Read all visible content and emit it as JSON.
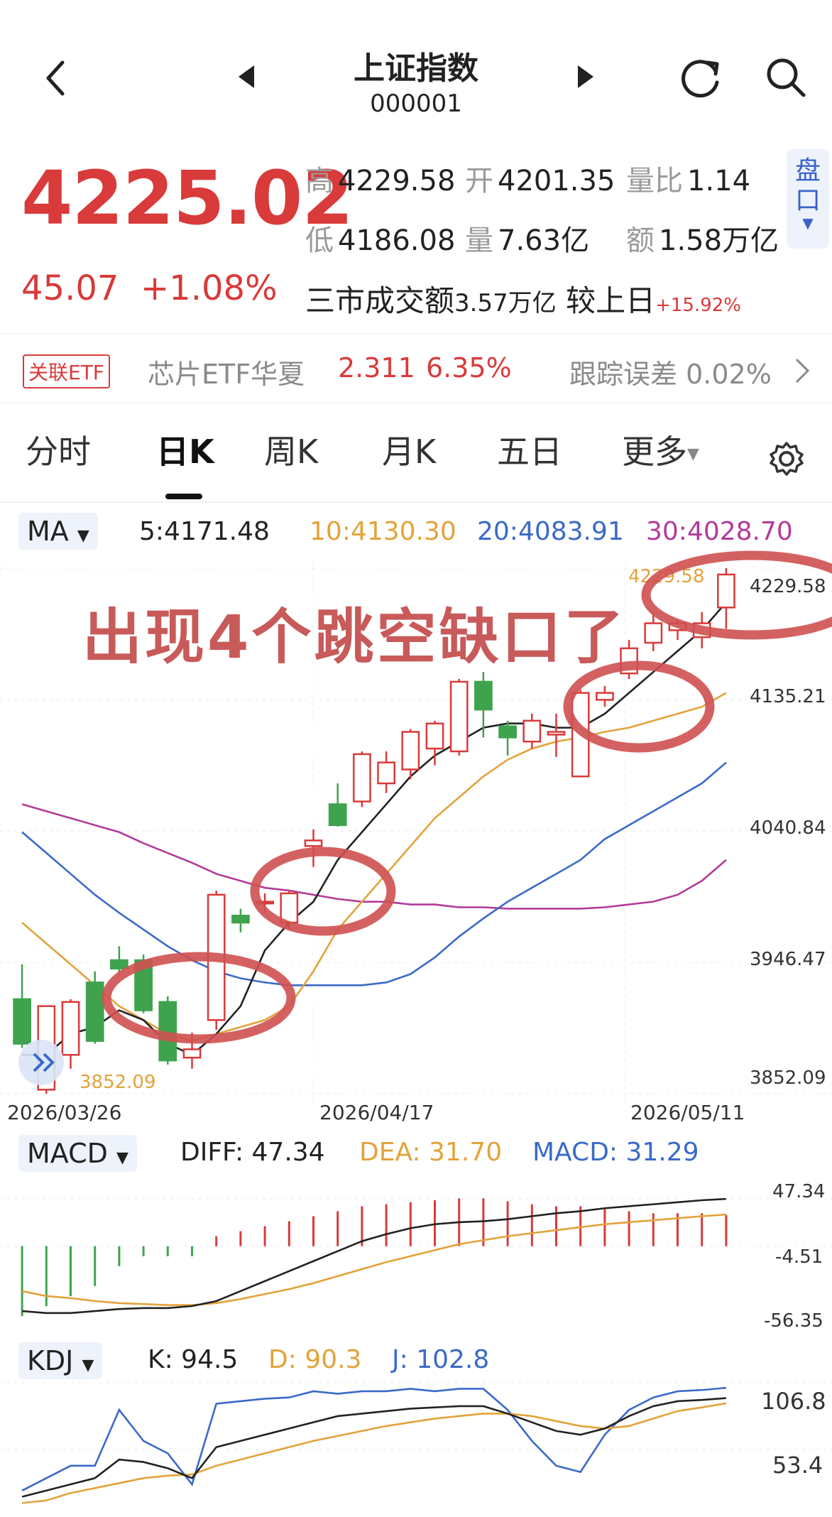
{
  "header": {
    "title": "上证指数",
    "code": "000001"
  },
  "quote": {
    "price": "4225.02",
    "change": "45.07",
    "change_pct": "+1.08%",
    "high_label": "高",
    "high": "4229.58",
    "open_label": "开",
    "open": "4201.35",
    "vol_ratio_label": "量比",
    "vol_ratio": "1.14",
    "low_label": "低",
    "low": "4186.08",
    "volume_label": "量",
    "volume": "7.63亿",
    "amount_label": "额",
    "amount": "1.58万亿",
    "market_label": "三市成交额",
    "market_amount": "3.57万亿",
    "vs_label": "较上日",
    "vs_value": "+15.92%",
    "pan_button": "盘口"
  },
  "etf": {
    "tag": "关联ETF",
    "name": "芯片ETF华夏",
    "price": "2.311",
    "pct": "6.35%",
    "track_label": "跟踪误差",
    "track_value": "0.02%"
  },
  "tabs": [
    {
      "label": "分时"
    },
    {
      "label": "日K"
    },
    {
      "label": "周K"
    },
    {
      "label": "月K"
    },
    {
      "label": "五日"
    },
    {
      "label": "更多"
    }
  ],
  "active_tab": "日K",
  "ma": {
    "select": "MA",
    "ma5": "5:4171.48",
    "ma10": "10:4130.30",
    "ma20": "20:4083.91",
    "ma30": "30:4028.70"
  },
  "annotation": "出现4个跳空缺口了",
  "macd_bar": {
    "select": "MACD",
    "diff": "DIFF: 47.34",
    "dea": "DEA: 31.70",
    "macd": "MACD: 31.29"
  },
  "kdj_bar": {
    "select": "KDJ",
    "k": "K: 94.5",
    "d": "D: 90.3",
    "j": "J: 102.8"
  },
  "colors": {
    "up": "#d93a3a",
    "down": "#3fa34d",
    "ma5": "#222222",
    "ma10": "#e3a23a",
    "ma20": "#3a6ac8",
    "ma30": "#b23a9a"
  },
  "chart_data": [
    {
      "type": "candlestick",
      "y_labels": [
        "4229.58",
        "4135.21",
        "4040.84",
        "3946.47",
        "3852.09"
      ],
      "y_range": [
        3852.09,
        4229.58
      ],
      "x_labels": [
        "2026/03/26",
        "2026/04/17",
        "2026/05/11"
      ],
      "max_marker": "4229.58",
      "min_marker": "3852.09",
      "candles": [
        {
          "o": 3920,
          "h": 3945,
          "l": 3885,
          "c": 3888
        },
        {
          "o": 3855,
          "h": 3915,
          "l": 3852,
          "c": 3915
        },
        {
          "o": 3880,
          "h": 3920,
          "l": 3870,
          "c": 3918
        },
        {
          "o": 3932,
          "h": 3940,
          "l": 3888,
          "c": 3890
        },
        {
          "o": 3948,
          "h": 3958,
          "l": 3938,
          "c": 3942
        },
        {
          "o": 3948,
          "h": 3952,
          "l": 3910,
          "c": 3912
        },
        {
          "o": 3918,
          "h": 3922,
          "l": 3873,
          "c": 3876
        },
        {
          "o": 3878,
          "h": 3896,
          "l": 3870,
          "c": 3884
        },
        {
          "o": 3905,
          "h": 3998,
          "l": 3898,
          "c": 3995
        },
        {
          "o": 3980,
          "h": 3985,
          "l": 3968,
          "c": 3975
        },
        {
          "o": 3990,
          "h": 3996,
          "l": 3982,
          "c": 3990
        },
        {
          "o": 3975,
          "h": 3998,
          "l": 3970,
          "c": 3996
        },
        {
          "o": 4030,
          "h": 4042,
          "l": 4015,
          "c": 4034
        },
        {
          "o": 4060,
          "h": 4075,
          "l": 4044,
          "c": 4045
        },
        {
          "o": 4062,
          "h": 4098,
          "l": 4058,
          "c": 4096
        },
        {
          "o": 4075,
          "h": 4098,
          "l": 4068,
          "c": 4090
        },
        {
          "o": 4085,
          "h": 4114,
          "l": 4078,
          "c": 4112
        },
        {
          "o": 4100,
          "h": 4120,
          "l": 4088,
          "c": 4118
        },
        {
          "o": 4098,
          "h": 4150,
          "l": 4095,
          "c": 4148
        },
        {
          "o": 4148,
          "h": 4155,
          "l": 4108,
          "c": 4128
        },
        {
          "o": 4116,
          "h": 4120,
          "l": 4095,
          "c": 4108
        },
        {
          "o": 4105,
          "h": 4125,
          "l": 4100,
          "c": 4120
        },
        {
          "o": 4110,
          "h": 4125,
          "l": 4094,
          "c": 4112
        },
        {
          "o": 4080,
          "h": 4142,
          "l": 4080,
          "c": 4140
        },
        {
          "o": 4135,
          "h": 4145,
          "l": 4130,
          "c": 4140
        },
        {
          "o": 4154,
          "h": 4178,
          "l": 4150,
          "c": 4172
        },
        {
          "o": 4176,
          "h": 4198,
          "l": 4170,
          "c": 4190
        },
        {
          "o": 4185,
          "h": 4193,
          "l": 4178,
          "c": 4190
        },
        {
          "o": 4180,
          "h": 4198,
          "l": 4172,
          "c": 4190
        },
        {
          "o": 4201.35,
          "h": 4229.58,
          "l": 4186.08,
          "c": 4225.02
        }
      ],
      "ma_lines": {
        "ma5": [
          3880,
          3880,
          3895,
          3900,
          3912,
          3905,
          3888,
          3880,
          3895,
          3915,
          3955,
          3975,
          3990,
          4020,
          4040,
          4060,
          4080,
          4095,
          4105,
          4115,
          4118,
          4118,
          4115,
          4115,
          4125,
          4140,
          4155,
          4170,
          4185,
          4205
        ],
        "ma10": [
          3975,
          3960,
          3945,
          3930,
          3915,
          3905,
          3895,
          3890,
          3895,
          3900,
          3905,
          3915,
          3940,
          3970,
          3990,
          4010,
          4030,
          4050,
          4065,
          4080,
          4092,
          4100,
          4105,
          4108,
          4112,
          4115,
          4120,
          4125,
          4130,
          4140
        ],
        "ma20": [
          4040,
          4025,
          4010,
          3995,
          3982,
          3970,
          3958,
          3948,
          3940,
          3935,
          3932,
          3930,
          3930,
          3930,
          3930,
          3932,
          3938,
          3950,
          3965,
          3978,
          3990,
          4000,
          4010,
          4020,
          4035,
          4045,
          4055,
          4065,
          4075,
          4090
        ],
        "ma30": [
          4060,
          4055,
          4050,
          4045,
          4040,
          4032,
          4025,
          4018,
          4010,
          4005,
          4000,
          3998,
          3995,
          3992,
          3990,
          3990,
          3988,
          3988,
          3986,
          3986,
          3985,
          3985,
          3985,
          3985,
          3986,
          3988,
          3990,
          3995,
          4005,
          4020
        ]
      }
    },
    {
      "type": "bar",
      "name": "MACD",
      "y_labels": [
        "47.34",
        "-4.51",
        "-56.35"
      ],
      "y_range": [
        -56.35,
        47.34
      ],
      "hist": [
        -70,
        -60,
        -50,
        -40,
        -20,
        -10,
        -10,
        -10,
        10,
        15,
        20,
        25,
        30,
        35,
        40,
        42,
        44,
        46,
        48,
        48,
        45,
        42,
        40,
        40,
        38,
        35,
        33,
        33,
        33,
        31.29
      ],
      "diff": [
        -65,
        -67,
        -67,
        -65,
        -63,
        -62,
        -62,
        -60,
        -55,
        -45,
        -35,
        -25,
        -15,
        -5,
        5,
        12,
        18,
        22,
        24,
        25,
        27,
        30,
        33,
        35,
        38,
        40,
        42,
        44,
        46,
        47.34
      ],
      "dea": [
        -45,
        -50,
        -52,
        -55,
        -57,
        -58,
        -59,
        -59,
        -57,
        -53,
        -48,
        -43,
        -37,
        -30,
        -23,
        -16,
        -10,
        -4,
        2,
        6,
        10,
        13,
        16,
        19,
        22,
        24,
        26,
        28,
        30,
        31.7
      ]
    },
    {
      "type": "line",
      "name": "KDJ",
      "y_labels": [
        "106.8",
        "53.4"
      ],
      "y_range": [
        0,
        106.8
      ],
      "k": [
        15,
        20,
        25,
        30,
        45,
        43,
        38,
        30,
        55,
        60,
        65,
        70,
        75,
        80,
        82,
        84,
        86,
        87,
        88,
        88,
        82,
        75,
        68,
        65,
        70,
        80,
        88,
        92,
        93,
        94.5
      ],
      "d": [
        10,
        12,
        18,
        22,
        26,
        30,
        32,
        33,
        40,
        45,
        50,
        55,
        60,
        64,
        68,
        72,
        75,
        78,
        80,
        82,
        82,
        80,
        76,
        72,
        70,
        72,
        78,
        84,
        87,
        90.3
      ],
      "j": [
        20,
        30,
        40,
        40,
        85,
        60,
        50,
        25,
        90,
        92,
        94,
        95,
        100,
        98,
        100,
        100,
        102,
        100,
        102,
        102,
        85,
        60,
        40,
        35,
        65,
        85,
        95,
        100,
        101,
        102.8
      ]
    }
  ]
}
